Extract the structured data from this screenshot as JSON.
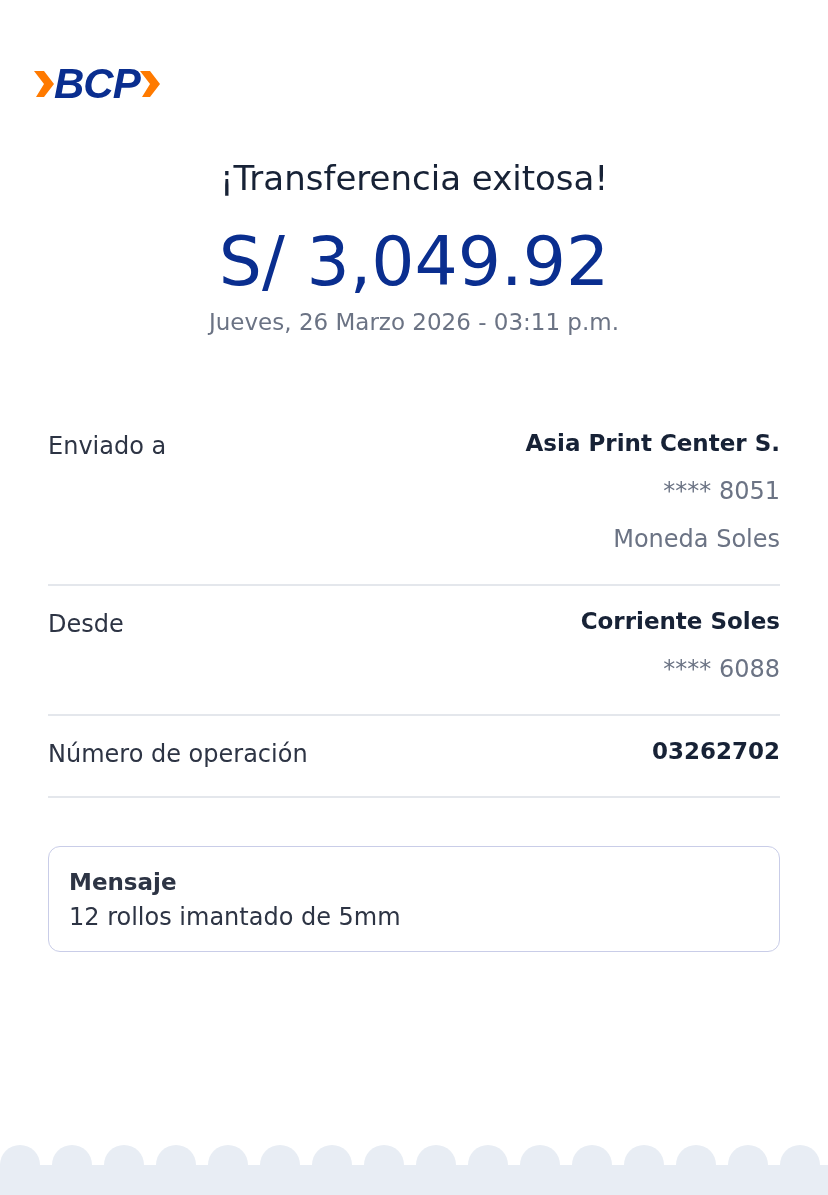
{
  "logo": {
    "text": "BCP"
  },
  "title": "¡Transferencia exitosa!",
  "amount": "S/ 3,049.92",
  "datetime": "Jueves, 26 Marzo 2026 - 03:11 p.m.",
  "details": [
    {
      "label": "Enviado a",
      "value": "Asia Print Center S.",
      "extra": [
        "**** 8051",
        "Moneda Soles"
      ]
    },
    {
      "label": "Desde",
      "value": "Corriente Soles",
      "extra": [
        "**** 6088"
      ]
    },
    {
      "label": "Número de operación",
      "value": "03262702"
    }
  ],
  "message": {
    "title": "Mensaje",
    "text": "12 rollos imantado de 5mm"
  }
}
